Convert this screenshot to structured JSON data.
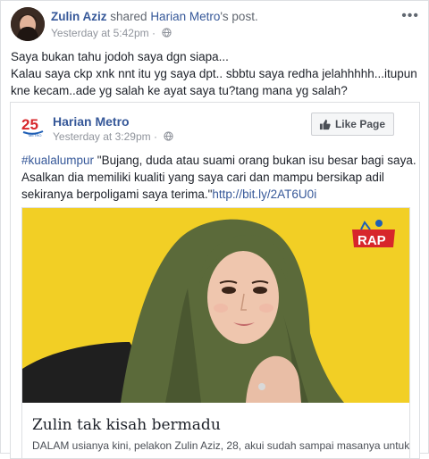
{
  "post": {
    "author": "Zulin Aziz",
    "shared_text": "shared",
    "source_page": "Harian Metro",
    "source_suffix": "'s post.",
    "time": "Yesterday at 5:42pm",
    "separator": "·",
    "more_label": "•••",
    "text_lines": [
      "Saya bukan tahu jodoh saya dgn siapa...",
      "Kalau saya ckp xnk nnt itu yg saya dpt.. sbbtu saya redha jelahhhhh...itupun",
      "kne kecam..ade yg salah ke ayat saya tu?tang mana yg salah?"
    ]
  },
  "shared": {
    "page_name": "Harian Metro",
    "logo_text": "25",
    "logo_sub": "METRO",
    "time": "Yesterday at 3:29pm",
    "separator": "·",
    "like_label": "Like Page",
    "hashtag": "#kualalumpur",
    "line1_rest": " \"Bujang, duda atau suami orang bukan isu besar bagi saya.",
    "line2": "Asalkan dia memiliki kualiti yang saya cari dan mampu bersikap adil",
    "line3_text": "sekiranya berpoligami saya terima.\"",
    "link": "http://bit.ly/2AT6U0i"
  },
  "article": {
    "title": "Zulin tak kisah bermadu",
    "description": "DALAM usianya kini, pelakon Zulin Aziz, 28, akui sudah sampai masanya untuk",
    "badge": "RAP",
    "colors": {
      "photo_bg": "#f2cf25",
      "hijab": "#5c6b3b",
      "badge_red": "#d7262b"
    }
  },
  "colors": {
    "link": "#365899",
    "text": "#1d2129",
    "meta": "#90949c",
    "border": "#dddfe2"
  }
}
